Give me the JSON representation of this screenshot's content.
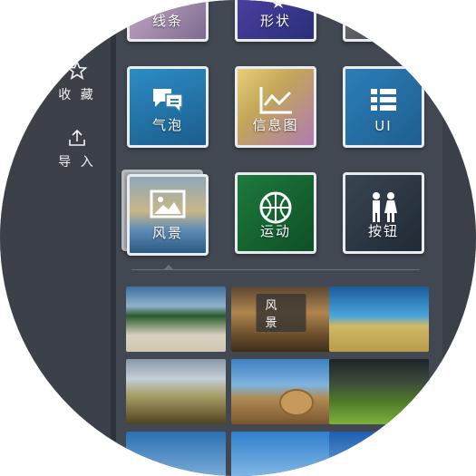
{
  "sidebar": {
    "items": [
      {
        "label": "收 藏",
        "icon": "star-icon"
      },
      {
        "label": "导 入",
        "icon": "upload-icon"
      }
    ]
  },
  "tiles": {
    "top_row": [
      {
        "label": "线条",
        "icon": "line-icon"
      },
      {
        "label": "形状",
        "icon": "star-shape-icon"
      },
      {
        "label": "",
        "icon": "partial-tile"
      }
    ],
    "row1": [
      {
        "label": "气泡",
        "icon": "chat-bubble-icon"
      },
      {
        "label": "信息图",
        "icon": "line-chart-icon"
      },
      {
        "label": "UI",
        "icon": "list-icon"
      }
    ],
    "row2": [
      {
        "label": "风景",
        "icon": "picture-icon"
      },
      {
        "label": "运动",
        "icon": "basketball-icon"
      },
      {
        "label": "按钮",
        "icon": "people-icon"
      }
    ]
  },
  "gallery": {
    "badge": "风 景",
    "photos": [
      "beach",
      "golden-landscape",
      "wheat-field-sky",
      "cloudy-field",
      "hay-bale",
      "green-field",
      "blue-sky-1",
      "blue-sky-2",
      "blue-sky-3"
    ]
  },
  "colors": {
    "background": "#424851",
    "sidebar": "#3c4149",
    "tile_border": "#e9ecef"
  }
}
